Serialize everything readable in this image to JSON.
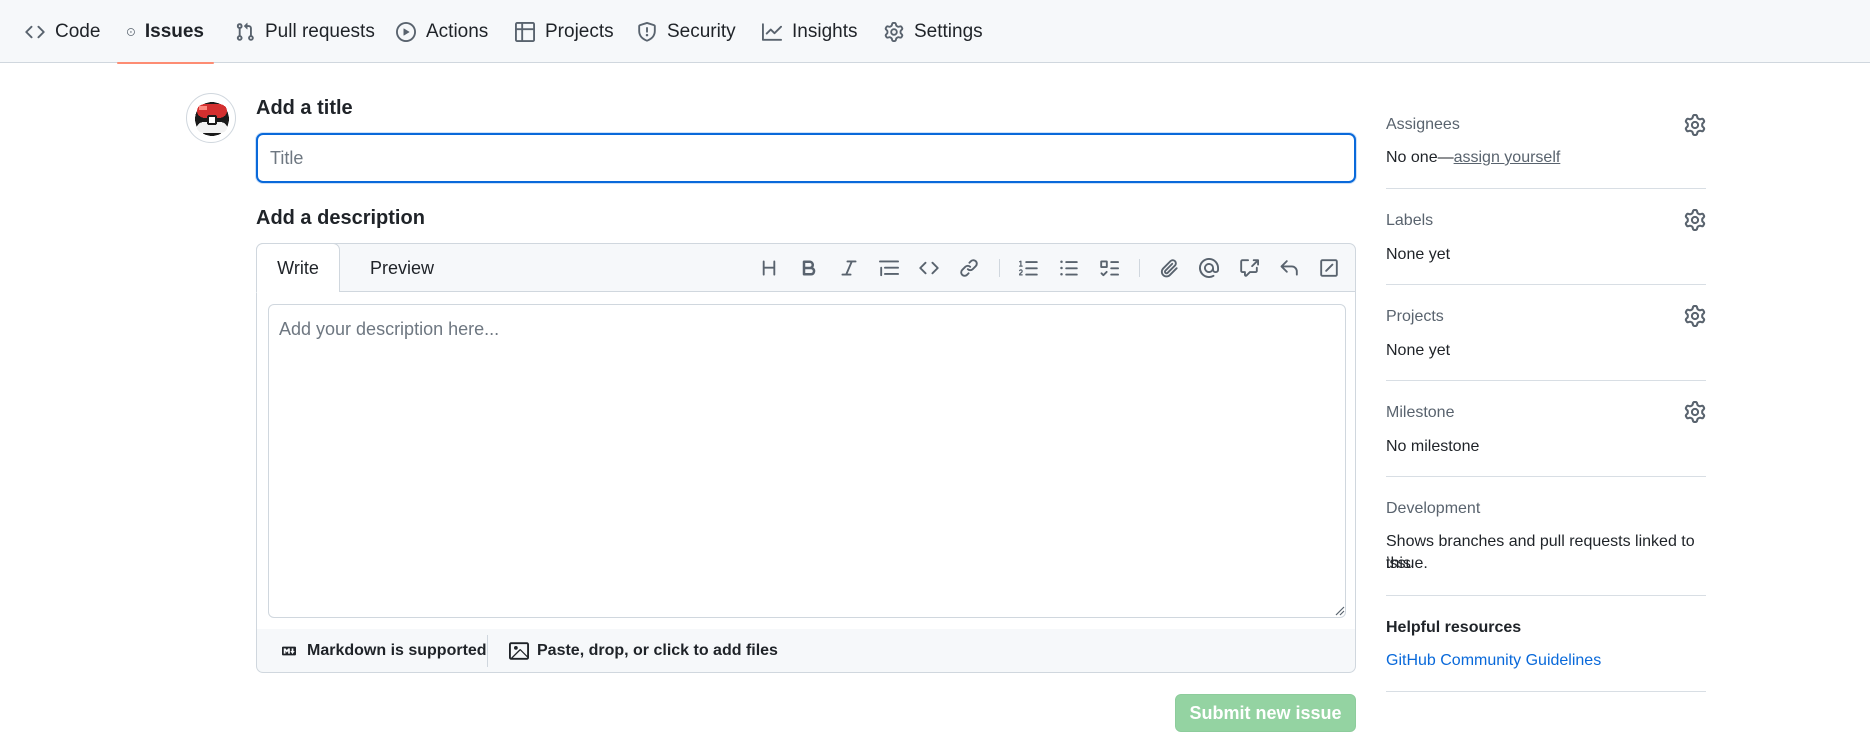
{
  "nav": {
    "tabs": [
      {
        "label": "Code",
        "icon": "code-icon"
      },
      {
        "label": "Issues",
        "icon": "issue-opened-icon",
        "active": true
      },
      {
        "label": "Pull requests",
        "icon": "git-pull-request-icon"
      },
      {
        "label": "Actions",
        "icon": "play-icon"
      },
      {
        "label": "Projects",
        "icon": "table-icon"
      },
      {
        "label": "Security",
        "icon": "shield-icon"
      },
      {
        "label": "Insights",
        "icon": "graph-icon"
      },
      {
        "label": "Settings",
        "icon": "gear-icon"
      }
    ]
  },
  "form": {
    "title_heading": "Add a title",
    "title_placeholder": "Title",
    "title_value": "",
    "description_heading": "Add a description",
    "tab_write": "Write",
    "tab_preview": "Preview",
    "description_placeholder": "Add your description here...",
    "description_value": "",
    "markdown_note": "Markdown is supported",
    "attach_note": "Paste, drop, or click to add files",
    "submit_label": "Submit new issue"
  },
  "toolbar": {
    "tools": [
      "heading-icon",
      "bold-icon",
      "italic-icon",
      "quote-icon",
      "code-icon",
      "link-icon",
      "ordered-list-icon",
      "unordered-list-icon",
      "task-list-icon",
      "paperclip-icon",
      "mention-icon",
      "cross-reference-icon",
      "reply-icon",
      "slash-command-icon"
    ]
  },
  "sidebar": {
    "assignees": {
      "heading": "Assignees",
      "value_prefix": "No one—",
      "value_link": "assign yourself"
    },
    "labels": {
      "heading": "Labels",
      "value": "None yet"
    },
    "projects": {
      "heading": "Projects",
      "value": "None yet"
    },
    "milestone": {
      "heading": "Milestone",
      "value": "No milestone"
    },
    "development": {
      "heading": "Development",
      "value_line1": "Shows branches and pull requests linked to this",
      "value_line2": "issue."
    },
    "helpful": {
      "heading": "Helpful resources",
      "link": "GitHub Community Guidelines"
    }
  },
  "colors": {
    "accent_blue": "#0969da",
    "submit_disabled_green": "#94d3a2",
    "active_tab_underline": "#fd8c73",
    "pokeball_red": "#d32f2f"
  }
}
